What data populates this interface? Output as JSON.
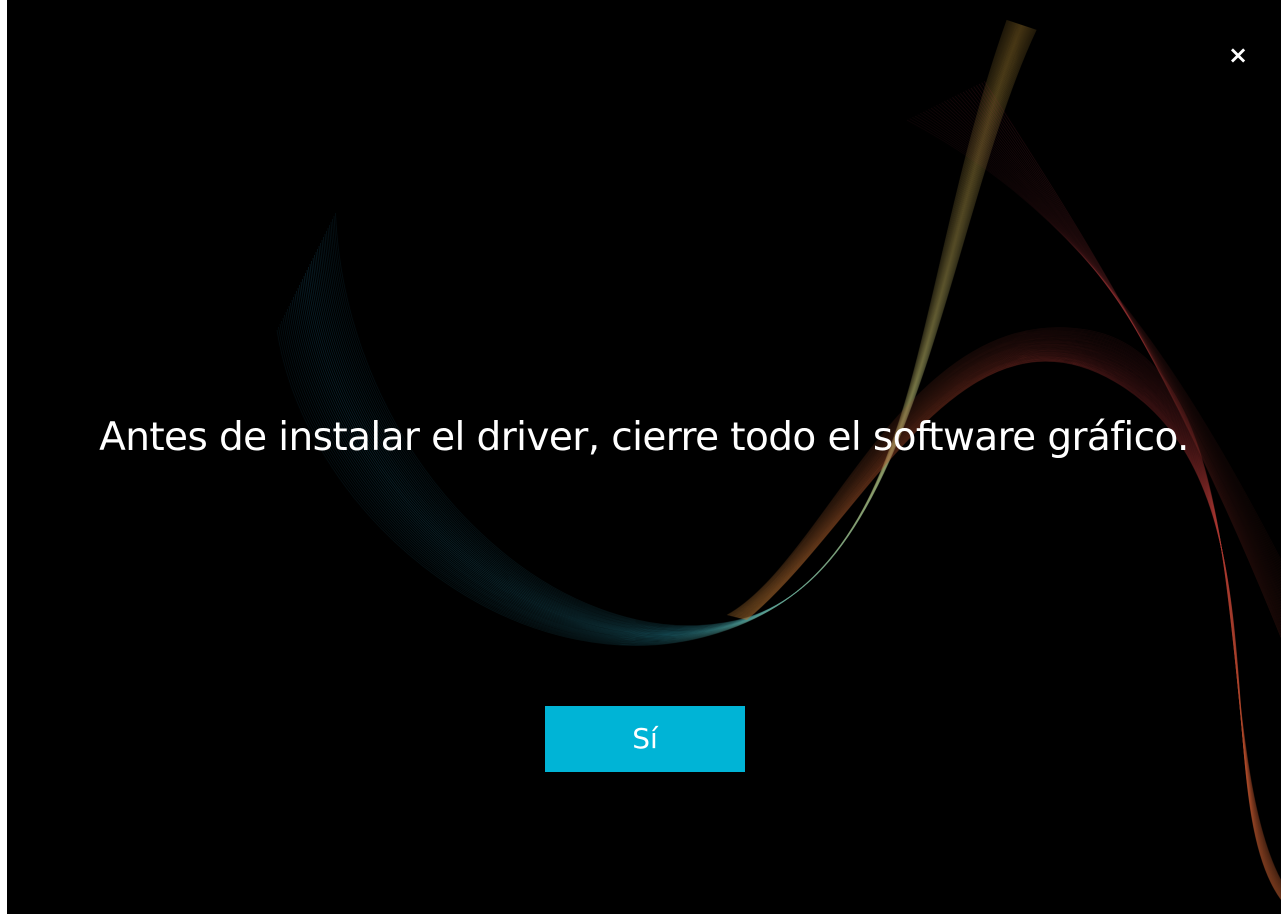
{
  "dialog": {
    "close_glyph": "×",
    "message": "Antes de instalar el driver, cierre todo el software gráfico.",
    "confirm_label": "Sí"
  },
  "colors": {
    "background": "#000000",
    "accent": "#00b4d6",
    "text": "#ffffff"
  },
  "icons": {
    "close": "close-icon"
  }
}
